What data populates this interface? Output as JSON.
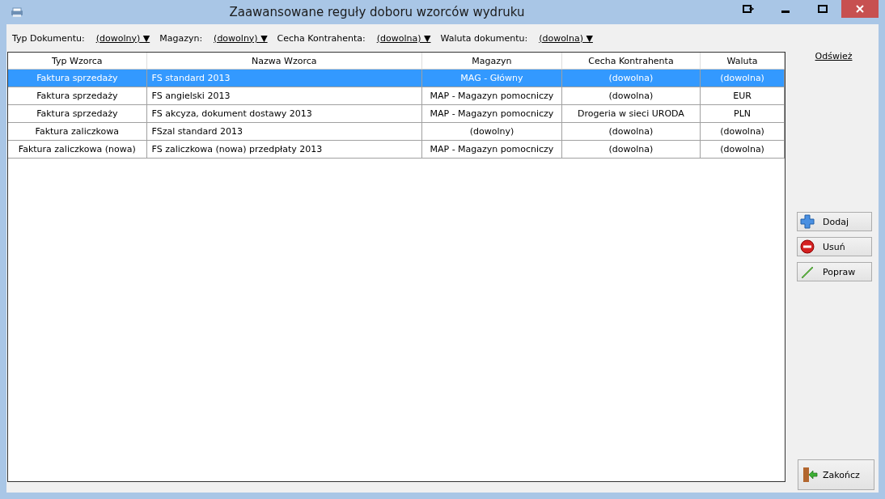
{
  "window": {
    "title": "Zaawansowane reguły doboru wzorców wydruku"
  },
  "filters": [
    {
      "label": "Typ Dokumentu:",
      "value": "(dowolny)",
      "arrow": "▼"
    },
    {
      "label": "Magazyn:",
      "value": "(dowolny)",
      "arrow": "▼"
    },
    {
      "label": "Cecha Kontrahenta:",
      "value": "(dowolna)",
      "arrow": "▼"
    },
    {
      "label": "Waluta dokumentu:",
      "value": "(dowolna)",
      "arrow": "▼"
    }
  ],
  "table": {
    "columns": [
      "Typ Wzorca",
      "Nazwa Wzorca",
      "Magazyn",
      "Cecha Kontrahenta",
      "Waluta"
    ],
    "rows": [
      {
        "selected": true,
        "cells": [
          "Faktura sprzedaży",
          "FS standard 2013",
          "MAG - Główny",
          "(dowolna)",
          "(dowolna)"
        ]
      },
      {
        "selected": false,
        "cells": [
          "Faktura sprzedaży",
          "FS angielski 2013",
          "MAP - Magazyn pomocniczy",
          "(dowolna)",
          "EUR"
        ]
      },
      {
        "selected": false,
        "cells": [
          "Faktura sprzedaży",
          "FS akcyza, dokument dostawy 2013",
          "MAP - Magazyn pomocniczy",
          "Drogeria w sieci URODA",
          "PLN"
        ]
      },
      {
        "selected": false,
        "cells": [
          "Faktura zaliczkowa",
          "FSzal standard 2013",
          "(dowolny)",
          "(dowolna)",
          "(dowolna)"
        ]
      },
      {
        "selected": false,
        "cells": [
          "Faktura zaliczkowa (nowa)",
          "FS zaliczkowa (nowa) przedpłaty 2013",
          "MAP - Magazyn pomocniczy",
          "(dowolna)",
          "(dowolna)"
        ]
      }
    ]
  },
  "refresh_link": "Odśwież",
  "actions": [
    {
      "kind": "add",
      "label": "Dodaj"
    },
    {
      "kind": "remove",
      "label": "Usuń"
    },
    {
      "kind": "edit",
      "label": "Popraw"
    }
  ],
  "close_button": {
    "label": "Zakończ"
  }
}
